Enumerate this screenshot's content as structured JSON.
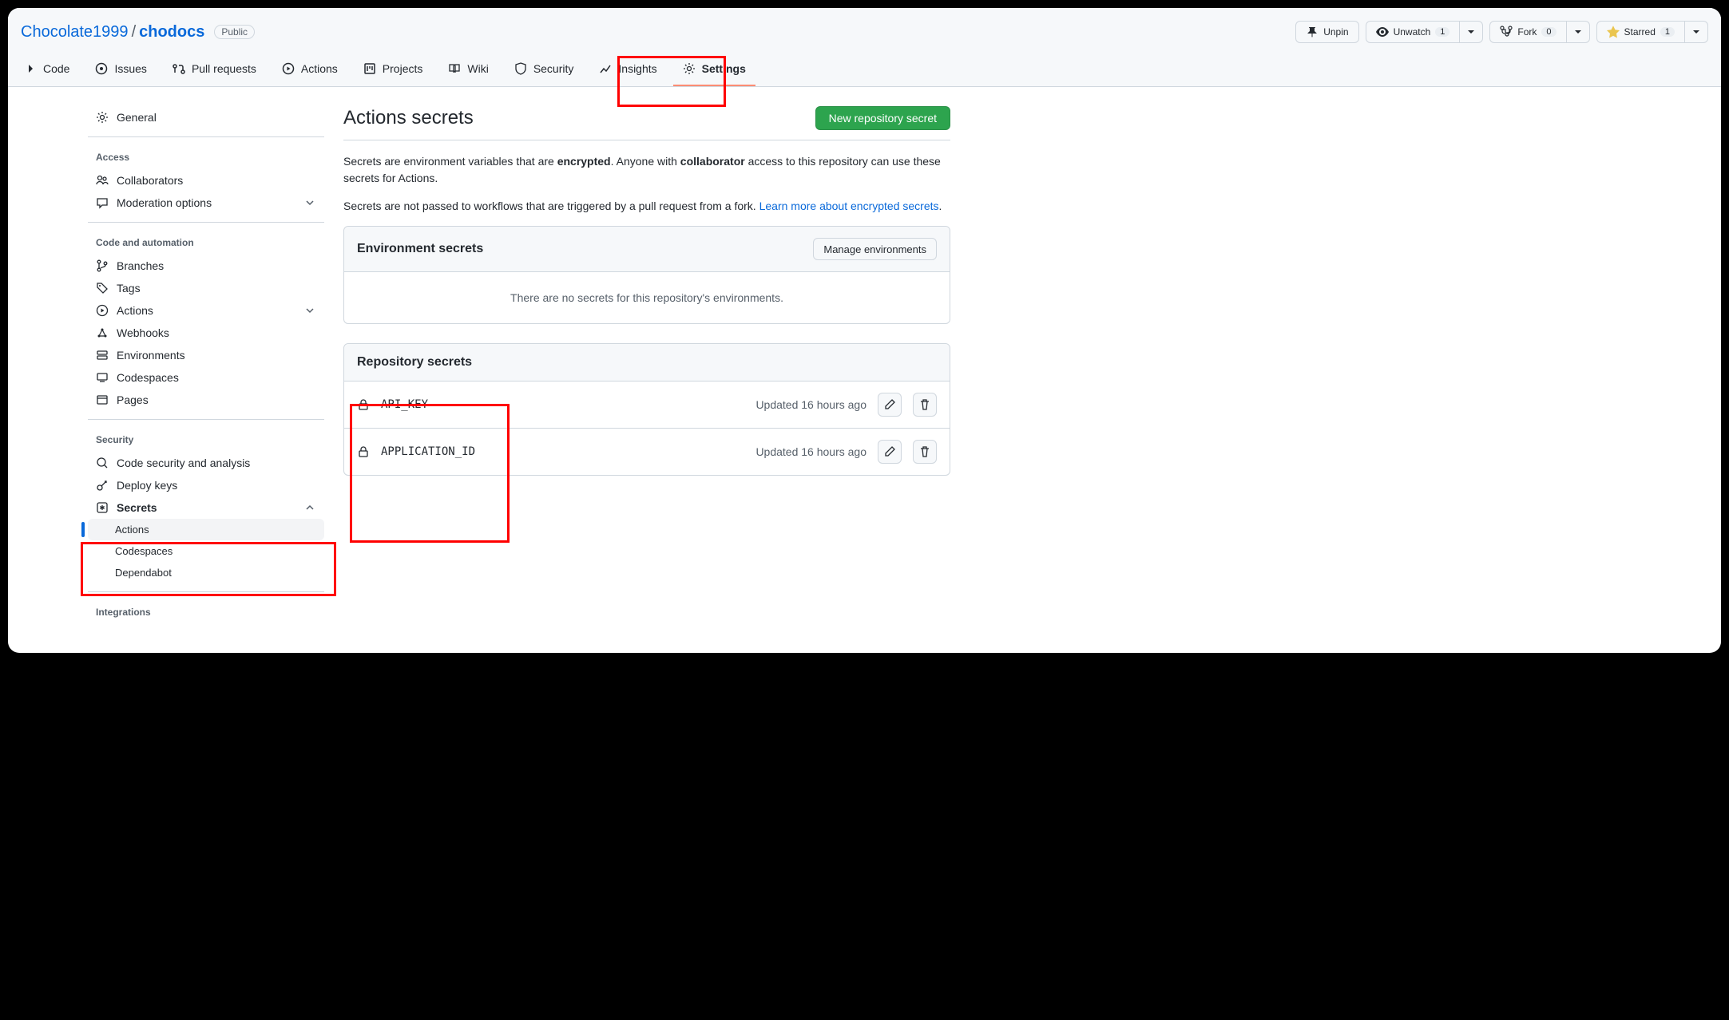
{
  "breadcrumb": {
    "owner": "Chocolate1999",
    "repo": "chodocs",
    "visibility": "Public"
  },
  "header_actions": {
    "unpin": "Unpin",
    "unwatch": "Unwatch",
    "watch_count": "1",
    "fork": "Fork",
    "fork_count": "0",
    "starred": "Starred",
    "star_count": "1"
  },
  "repo_nav": {
    "code": "Code",
    "issues": "Issues",
    "pulls": "Pull requests",
    "actions": "Actions",
    "projects": "Projects",
    "wiki": "Wiki",
    "security": "Security",
    "insights": "Insights",
    "settings": "Settings"
  },
  "sidebar": {
    "general": "General",
    "access_heading": "Access",
    "collaborators": "Collaborators",
    "moderation": "Moderation options",
    "code_heading": "Code and automation",
    "branches": "Branches",
    "tags": "Tags",
    "actions": "Actions",
    "webhooks": "Webhooks",
    "environments": "Environments",
    "codespaces": "Codespaces",
    "pages": "Pages",
    "security_heading": "Security",
    "code_security": "Code security and analysis",
    "deploy_keys": "Deploy keys",
    "secrets": "Secrets",
    "secrets_actions": "Actions",
    "secrets_codespaces": "Codespaces",
    "secrets_dependabot": "Dependabot",
    "integrations_heading": "Integrations"
  },
  "page": {
    "title": "Actions secrets",
    "new_button": "New repository secret",
    "desc1a": "Secrets are environment variables that are ",
    "desc1b": "encrypted",
    "desc1c": ". Anyone with ",
    "desc1d": "collaborator",
    "desc1e": " access to this repository can use these secrets for Actions.",
    "desc2a": "Secrets are not passed to workflows that are triggered by a pull request from a fork. ",
    "desc2b": "Learn more about encrypted secrets",
    "desc2c": "."
  },
  "env_panel": {
    "title": "Environment secrets",
    "manage": "Manage environments",
    "empty": "There are no secrets for this repository's environments."
  },
  "repo_panel": {
    "title": "Repository secrets",
    "secrets": [
      {
        "name": "API_KEY",
        "updated": "Updated 16 hours ago"
      },
      {
        "name": "APPLICATION_ID",
        "updated": "Updated 16 hours ago"
      }
    ]
  }
}
